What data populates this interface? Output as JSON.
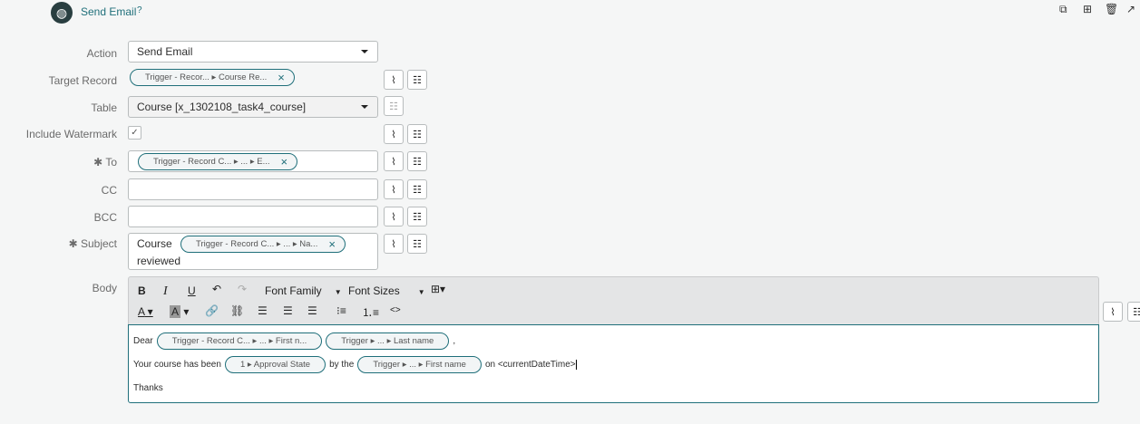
{
  "header": {
    "title": "Send Email",
    "help": "?"
  },
  "form": {
    "action": {
      "label": "Action",
      "value": "Send Email"
    },
    "target_record": {
      "label": "Target Record",
      "pill": "Trigger - Recor... ▸ Course Re..."
    },
    "table": {
      "label": "Table",
      "value": "Course [x_1302108_task4_course]"
    },
    "watermark": {
      "label": "Include Watermark",
      "checked": true,
      "check": "✓"
    },
    "to": {
      "label": "✱ To",
      "pill": "Trigger - Record C... ▸ ... ▸ E..."
    },
    "cc": {
      "label": "CC",
      "value": ""
    },
    "bcc": {
      "label": "BCC",
      "value": ""
    },
    "subject": {
      "label": "✱ Subject",
      "prefix": "Course",
      "pill": "Trigger - Record C... ▸ ... ▸ Na...",
      "suffix": "reviewed"
    },
    "body": {
      "label": "Body"
    }
  },
  "toolbar": {
    "bold": "B",
    "italic": "I",
    "underline": "U",
    "font_family": "Font Family",
    "font_sizes": "Font Sizes",
    "font_color": "A",
    "bg_color": "A",
    "code": "<>"
  },
  "editor": {
    "line1": {
      "text": "Dear",
      "pill1": "Trigger - Record C... ▸ ... ▸ First n...",
      "pill2": "Trigger ▸ ... ▸ Last name",
      "end": ","
    },
    "line2": {
      "text": "Your course has been",
      "pill1": "1 ▸ Approval State",
      "mid": "by the",
      "pill2": "Trigger ▸ ... ▸ First name",
      "end": "on <currentDateTime>"
    },
    "line3": {
      "text": "Thanks"
    }
  }
}
